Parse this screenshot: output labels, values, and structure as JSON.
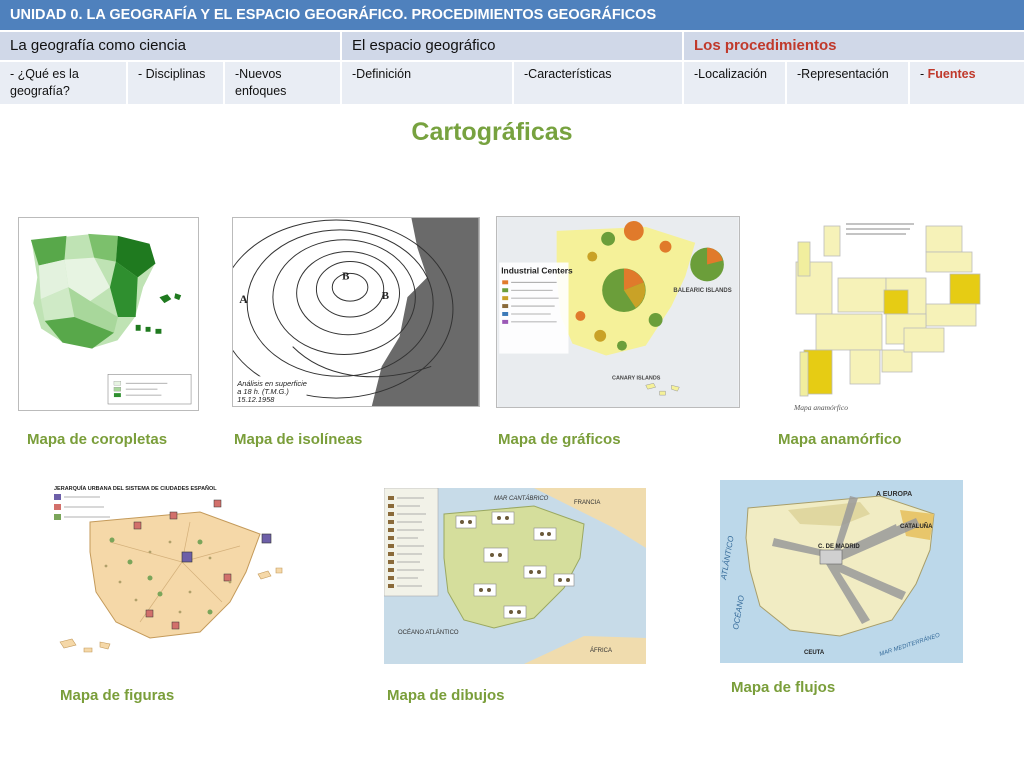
{
  "header": {
    "title": "UNIDAD 0.  LA GEOGRAFÍA Y EL ESPACIO GEOGRÁFICO. PROCEDIMIENTOS GEOGRÁFICOS"
  },
  "sections": [
    {
      "label": "La geografía como ciencia"
    },
    {
      "label": "El espacio geográfico"
    },
    {
      "label": "Los procedimientos"
    }
  ],
  "subsections": {
    "que_es_1": "-  ¿Qué es la",
    "que_es_2": "geografía?",
    "disciplinas": "- Disciplinas",
    "enfoques_1": "-Nuevos",
    "enfoques_2": "enfoques",
    "definicion": "-Definición",
    "caracteristicas": "-Características",
    "localizacion": "-Localización",
    "representacion": "-Representación",
    "fuentes_prefix": "- ",
    "fuentes": "Fuentes"
  },
  "page_title": "Cartográficas",
  "maps": [
    {
      "caption": "Mapa de coropletas"
    },
    {
      "caption": "Mapa de isolíneas"
    },
    {
      "caption": "Mapa de gráficos"
    },
    {
      "caption": "Mapa  anamórfico"
    },
    {
      "caption": "Mapa de figuras"
    },
    {
      "caption": "Mapa de dibujos"
    },
    {
      "caption": "Mapa de flujos"
    }
  ],
  "map_texts": {
    "isolines_1": "Análisis en superficie",
    "isolines_2": "a 18 h. (T.M.G.)",
    "isolines_3": "15.12.1958",
    "industrial": "Industrial Centers",
    "balearic": "BALEARIC ISLANDS",
    "canary": "CANARY ISLANDS",
    "anamorphic": "Mapa anamórfico",
    "figuras_title": "JERARQUÍA URBANA DEL SISTEMA DE CIUDADES ESPAÑOL",
    "mar_cantabrico": "MAR CANTÁBRICO",
    "francia": "FRANCIA",
    "oceano_atlantico": "OCÉANO ATLÁNTICO",
    "africa": "ÁFRICA",
    "mar_med": "MAR MEDITERRÁNEO",
    "flow_atlantico": "ATLÁNTICO",
    "flow_oceano": "OCÉANO",
    "flow_europa": "A EUROPA",
    "flow_madrid": "C. DE MADRID",
    "flow_cataluna": "CATALUÑA",
    "flow_ceuta": "CEUTA"
  },
  "colors": {
    "header_bg": "#4f81bd",
    "section_bg": "#d0d8e8",
    "subsection_bg": "#e9edf4",
    "accent_red": "#c0392b",
    "caption_green": "#7a9e3a",
    "title_green": "#77a23f"
  }
}
